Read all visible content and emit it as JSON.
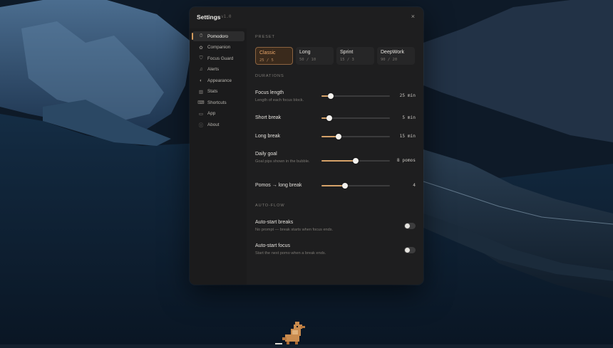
{
  "window": {
    "title": "Settings",
    "version": "v1.0"
  },
  "colors": {
    "accent": "#d6a269",
    "panel": "#1e1e1f",
    "sidebar": "#1b1b1c"
  },
  "sidebar": {
    "items": [
      {
        "label": "Pomodoro",
        "icon": "timer-icon",
        "active": true
      },
      {
        "label": "Companion",
        "icon": "companion-icon"
      },
      {
        "label": "Focus Guard",
        "icon": "shield-icon"
      },
      {
        "label": "Alerts",
        "icon": "bell-icon"
      },
      {
        "label": "Appearance",
        "icon": "contrast-icon"
      },
      {
        "label": "Stats",
        "icon": "bar-chart-icon"
      },
      {
        "label": "Shortcuts",
        "icon": "keyboard-icon"
      },
      {
        "label": "App",
        "icon": "monitor-icon"
      },
      {
        "label": "About",
        "icon": "info-icon"
      }
    ]
  },
  "preset": {
    "heading": "PRESET",
    "options": [
      {
        "name": "Classic",
        "value": "25 / 5",
        "selected": true
      },
      {
        "name": "Long",
        "value": "50 / 10"
      },
      {
        "name": "Sprint",
        "value": "15 / 3"
      },
      {
        "name": "DeepWork",
        "value": "90 / 20"
      }
    ]
  },
  "durations": {
    "heading": "DURATIONS",
    "rows": [
      {
        "label": "Focus length",
        "desc": "Length of each focus block.",
        "value": "25 min",
        "level": 0.14
      },
      {
        "label": "Short break",
        "desc": "",
        "value": "5 min",
        "level": 0.11
      },
      {
        "label": "Long break",
        "desc": "",
        "value": "15 min",
        "level": 0.25
      },
      {
        "label": "Daily goal",
        "desc": "Goal pips shown in the bubble.",
        "value": "8 pomos",
        "level": 0.5
      },
      {
        "label": "Pomos → long break",
        "desc": "",
        "value": "4",
        "level": 0.34
      }
    ]
  },
  "autoflow": {
    "heading": "AUTO-FLOW",
    "rows": [
      {
        "label": "Auto-start breaks",
        "desc": "No prompt — break starts when focus ends.",
        "on": false
      },
      {
        "label": "Auto-start focus",
        "desc": "Start the next pomo when a break ends.",
        "on": false
      }
    ]
  },
  "close_label": "×"
}
